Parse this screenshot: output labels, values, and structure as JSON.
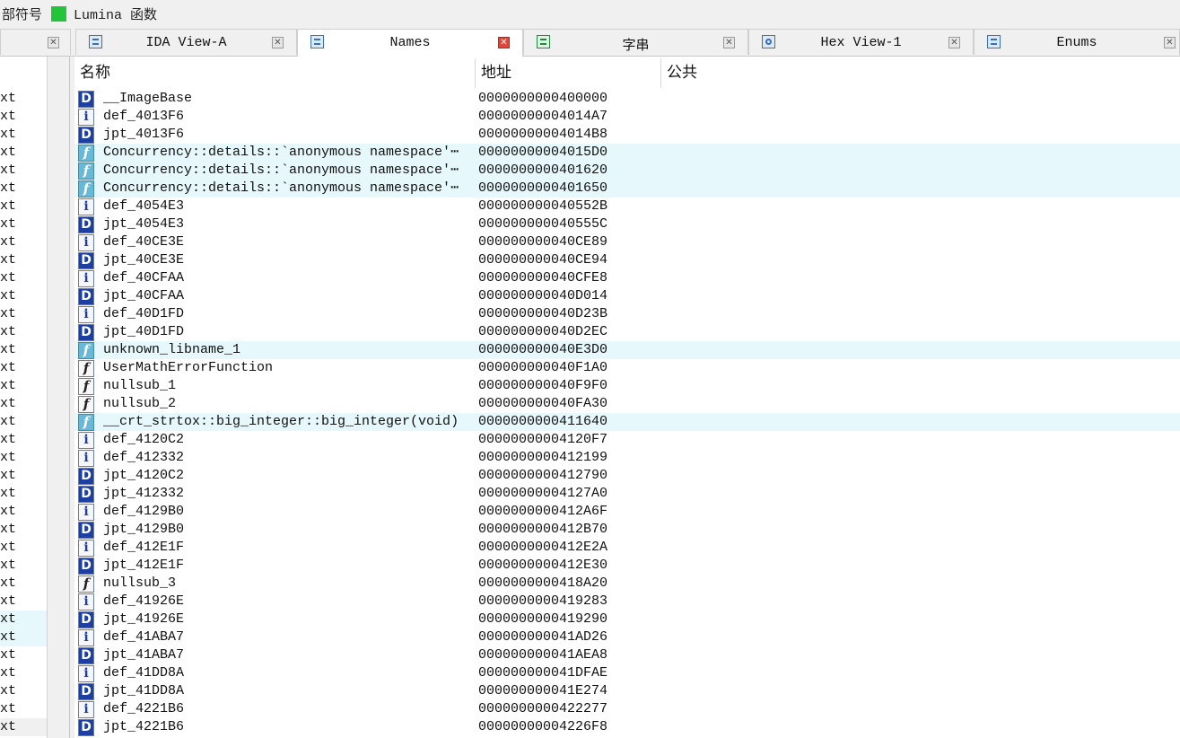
{
  "legend": {
    "label1": "部符号",
    "swatch_color": "#22c43a",
    "label2": "Lumina 函数"
  },
  "tabs": [
    {
      "label": "IDA View-A",
      "icon": "disassembly-view-icon",
      "active": false
    },
    {
      "label": "Names",
      "icon": "names-window-icon",
      "active": true
    },
    {
      "label": "字串",
      "icon": "strings-window-icon",
      "active": false
    },
    {
      "label": "Hex View-1",
      "icon": "hex-view-icon",
      "active": false
    },
    {
      "label": "Enums",
      "icon": "enums-window-icon",
      "active": false
    }
  ],
  "columns": {
    "name": "名称",
    "address": "地址",
    "public": "公共"
  },
  "left_pane_text": "ext",
  "rows": [
    {
      "type": "D",
      "name": "__ImageBase",
      "address": "0000000000400000",
      "hl": false
    },
    {
      "type": "i",
      "name": "def_4013F6",
      "address": "00000000004014A7",
      "hl": false
    },
    {
      "type": "D",
      "name": "jpt_4013F6",
      "address": "00000000004014B8",
      "hl": false
    },
    {
      "type": "lf",
      "name": "Concurrency::details::`anonymous namespace'⋯",
      "address": "00000000004015D0",
      "hl": true
    },
    {
      "type": "lf",
      "name": "Concurrency::details::`anonymous namespace'⋯",
      "address": "0000000000401620",
      "hl": true
    },
    {
      "type": "lf",
      "name": "Concurrency::details::`anonymous namespace'⋯",
      "address": "0000000000401650",
      "hl": true
    },
    {
      "type": "i",
      "name": "def_4054E3",
      "address": "000000000040552B",
      "hl": false
    },
    {
      "type": "D",
      "name": "jpt_4054E3",
      "address": "000000000040555C",
      "hl": false
    },
    {
      "type": "i",
      "name": "def_40CE3E",
      "address": "000000000040CE89",
      "hl": false
    },
    {
      "type": "D",
      "name": "jpt_40CE3E",
      "address": "000000000040CE94",
      "hl": false
    },
    {
      "type": "i",
      "name": "def_40CFAA",
      "address": "000000000040CFE8",
      "hl": false
    },
    {
      "type": "D",
      "name": "jpt_40CFAA",
      "address": "000000000040D014",
      "hl": false
    },
    {
      "type": "i",
      "name": "def_40D1FD",
      "address": "000000000040D23B",
      "hl": false
    },
    {
      "type": "D",
      "name": "jpt_40D1FD",
      "address": "000000000040D2EC",
      "hl": false
    },
    {
      "type": "lf",
      "name": "unknown_libname_1",
      "address": "000000000040E3D0",
      "hl": true
    },
    {
      "type": "f",
      "name": "UserMathErrorFunction",
      "address": "000000000040F1A0",
      "hl": false
    },
    {
      "type": "f",
      "name": "nullsub_1",
      "address": "000000000040F9F0",
      "hl": false
    },
    {
      "type": "f",
      "name": "nullsub_2",
      "address": "000000000040FA30",
      "hl": false
    },
    {
      "type": "lf",
      "name": "__crt_strtox::big_integer::big_integer(void)",
      "address": "0000000000411640",
      "hl": true
    },
    {
      "type": "i",
      "name": "def_4120C2",
      "address": "00000000004120F7",
      "hl": false
    },
    {
      "type": "i",
      "name": "def_412332",
      "address": "0000000000412199",
      "hl": false
    },
    {
      "type": "D",
      "name": "jpt_4120C2",
      "address": "0000000000412790",
      "hl": false
    },
    {
      "type": "D",
      "name": "jpt_412332",
      "address": "00000000004127A0",
      "hl": false
    },
    {
      "type": "i",
      "name": "def_4129B0",
      "address": "0000000000412A6F",
      "hl": false
    },
    {
      "type": "D",
      "name": "jpt_4129B0",
      "address": "0000000000412B70",
      "hl": false
    },
    {
      "type": "i",
      "name": "def_412E1F",
      "address": "0000000000412E2A",
      "hl": false
    },
    {
      "type": "D",
      "name": "jpt_412E1F",
      "address": "0000000000412E30",
      "hl": false
    },
    {
      "type": "f",
      "name": "nullsub_3",
      "address": "0000000000418A20",
      "hl": false
    },
    {
      "type": "i",
      "name": "def_41926E",
      "address": "0000000000419283",
      "hl": false
    },
    {
      "type": "D",
      "name": "jpt_41926E",
      "address": "0000000000419290",
      "hl": false
    },
    {
      "type": "i",
      "name": "def_41ABA7",
      "address": "000000000041AD26",
      "hl": false
    },
    {
      "type": "D",
      "name": "jpt_41ABA7",
      "address": "000000000041AEA8",
      "hl": false
    },
    {
      "type": "i",
      "name": "def_41DD8A",
      "address": "000000000041DFAE",
      "hl": false
    },
    {
      "type": "D",
      "name": "jpt_41DD8A",
      "address": "000000000041E274",
      "hl": false
    },
    {
      "type": "i",
      "name": "def_4221B6",
      "address": "0000000000422277",
      "hl": false
    },
    {
      "type": "D",
      "name": "jpt_4221B6",
      "address": "00000000004226F8",
      "hl": false
    }
  ]
}
